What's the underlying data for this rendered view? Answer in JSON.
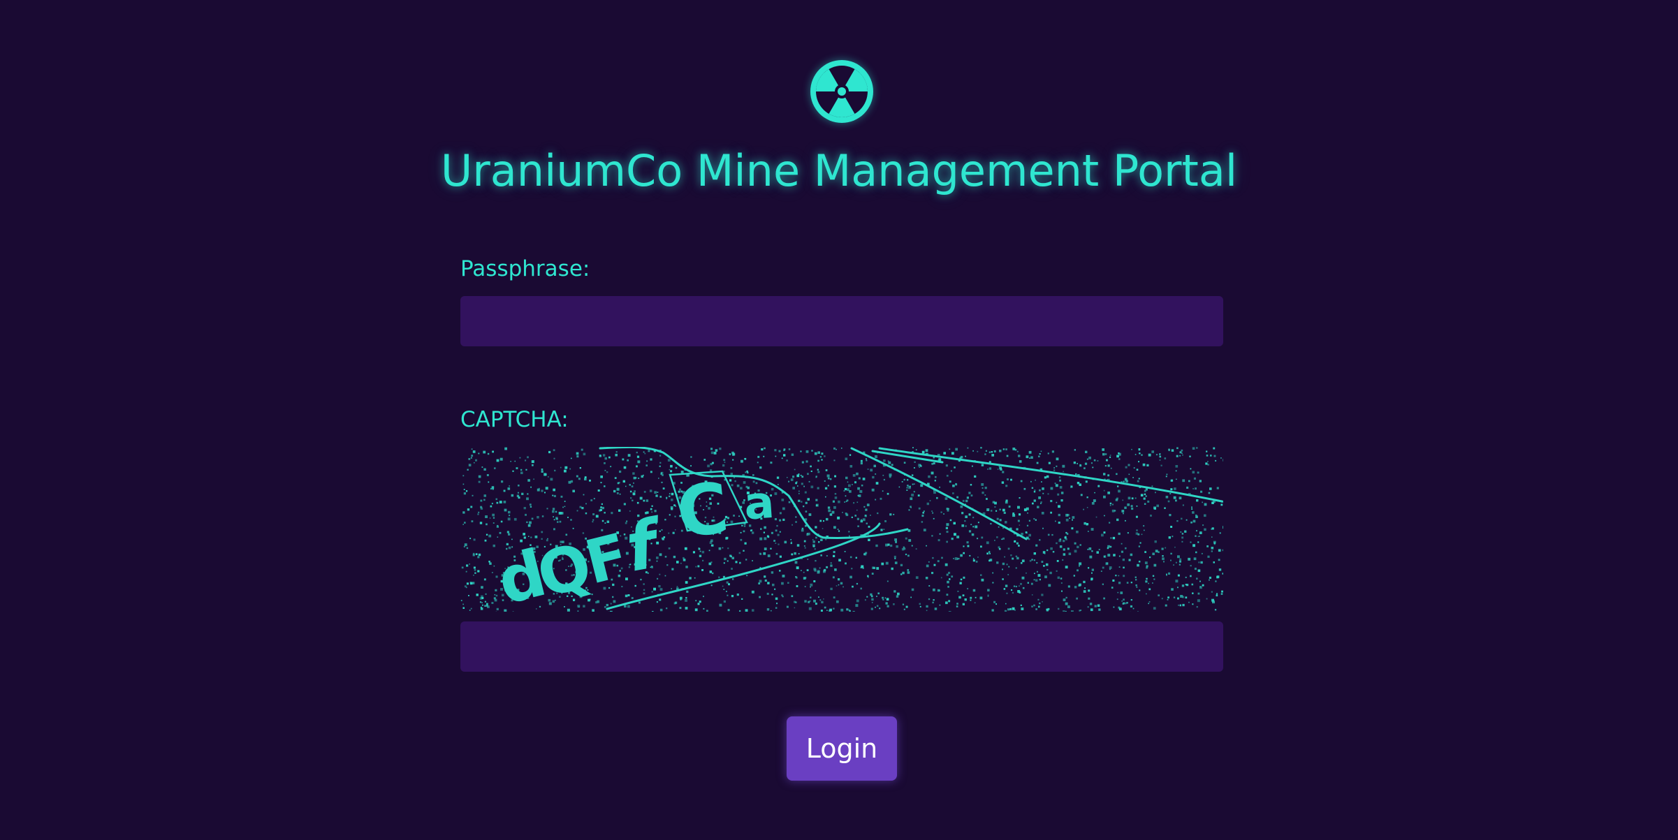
{
  "app": {
    "title": "UraniumCo Mine Management Portal",
    "logo_icon": "radiation-icon"
  },
  "form": {
    "passphrase_label": "Passphrase:",
    "passphrase_value": "",
    "captcha_label": "CAPTCHA:",
    "captcha_text": "dQFf Ca",
    "captcha_value": "",
    "login_label": "Login"
  },
  "colors": {
    "background": "#1a0a33",
    "accent": "#2fe6d0",
    "field": "#32125e",
    "button": "#6a3fc2"
  }
}
